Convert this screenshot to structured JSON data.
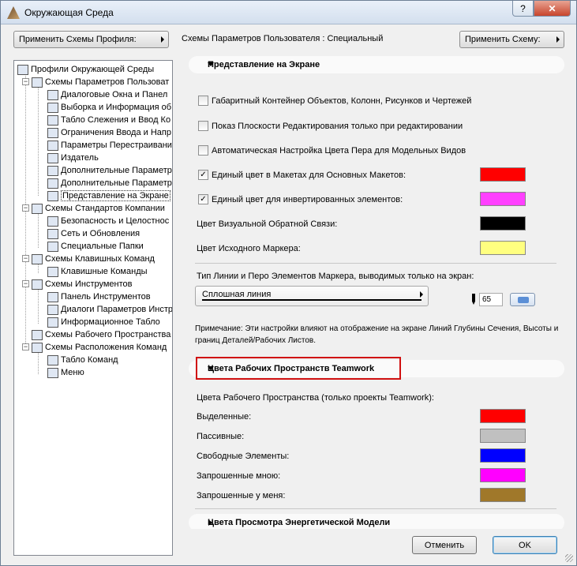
{
  "window": {
    "title": "Окружающая Среда",
    "help_label": "?",
    "close_label": "✕"
  },
  "toolbar": {
    "apply_profile_scheme": "Применить Схемы Профиля:",
    "scheme_label": "Схемы Параметров Пользователя : Специальный",
    "apply_scheme": "Применить Схему:"
  },
  "tree": {
    "items": [
      {
        "label": "Профили Окружающей Среды",
        "icon": "profiles-icon"
      },
      {
        "label": "Схемы Параметров Пользоват",
        "icon": "user-prefs-icon"
      },
      {
        "label": "Диалоговые Окна и Панел",
        "icon": "dialogs-icon"
      },
      {
        "label": "Выборка и Информация об",
        "icon": "selection-icon"
      },
      {
        "label": "Табло Слежения и Ввод Ко",
        "icon": "tracker-icon"
      },
      {
        "label": "Ограничения Ввода и Напр",
        "icon": "constraints-icon"
      },
      {
        "label": "Параметры Перестраивани",
        "icon": "rebuild-icon"
      },
      {
        "label": "Издатель",
        "icon": "publisher-icon"
      },
      {
        "label": "Дополнительные Параметр",
        "icon": "more-options-icon"
      },
      {
        "label": "Дополнительные Параметр",
        "icon": "more-options-2-icon"
      },
      {
        "label": "Представление на Экране",
        "icon": "on-screen-view-icon"
      },
      {
        "label": "Схемы Стандартов Компании",
        "icon": "company-standards-icon"
      },
      {
        "label": "Безопасность и Целостнос",
        "icon": "security-icon"
      },
      {
        "label": "Сеть и Обновления",
        "icon": "network-icon"
      },
      {
        "label": "Специальные Папки",
        "icon": "folders-icon"
      },
      {
        "label": "Схемы Клавишных Команд",
        "icon": "shortcut-schemes-icon"
      },
      {
        "label": "Клавишные Команды",
        "icon": "keyboard-icon"
      },
      {
        "label": "Схемы Инструментов",
        "icon": "tool-schemes-icon"
      },
      {
        "label": "Панель Инструментов",
        "icon": "toolbar-icon"
      },
      {
        "label": "Диалоги Параметров Инстр",
        "icon": "tool-settings-icon"
      },
      {
        "label": "Информационное Табло",
        "icon": "info-box-icon"
      },
      {
        "label": "Схемы Рабочего Пространства",
        "icon": "workspace-icon"
      },
      {
        "label": "Схемы Расположения Команд",
        "icon": "command-layout-icon"
      },
      {
        "label": "Табло Команд",
        "icon": "command-table-icon"
      },
      {
        "label": "Меню",
        "icon": "menu-icon"
      }
    ]
  },
  "screen_view": {
    "title": "Представление на Экране",
    "options": [
      {
        "label": "Габаритный Контейнер Объектов, Колонн, Рисунков и Чертежей",
        "checked": false
      },
      {
        "label": "Показ Плоскости Редактирования только при редактировании",
        "checked": false
      },
      {
        "label": "Автоматическая Настройка Цвета Пера для Модельных Видов",
        "checked": false
      },
      {
        "label": "Единый цвет в Макетах для Основных Макетов:",
        "checked": true,
        "color": "#ff0000"
      },
      {
        "label": "Единый цвет для инвертированных элементов:",
        "checked": true,
        "color": "#ff40ff"
      }
    ],
    "check_mark": "✓",
    "feedback_color_label": "Цвет Визуальной Обратной Связи:",
    "feedback_color": "#000000",
    "source_marker_label": "Цвет Исходного Маркера:",
    "source_marker_color": "#ffff80",
    "line_type_label": "Тип Линии и Перо Элементов Маркера, выводимых только на экран:",
    "line_type_value": "Сплошная линия",
    "pen_number": "65",
    "note": "Примечание: Эти настройки влияют на отображение на экране Линий Глубины Сечения, Высоты и границ Деталей/Рабочих Листов."
  },
  "teamwork": {
    "title": "Цвета Рабочих Пространств Teamwork",
    "subtitle": "Цвета Рабочего Пространства (только проекты Teamwork):",
    "rows": [
      {
        "label": "Выделенные:",
        "color": "#ff0000"
      },
      {
        "label": "Пассивные:",
        "color": "#c0c0c0"
      },
      {
        "label": "Свободные Элементы:",
        "color": "#0000ff"
      },
      {
        "label": "Запрошенные мною:",
        "color": "#ff00ff"
      },
      {
        "label": "Запрошенные у меня:",
        "color": "#a0782a"
      }
    ]
  },
  "energy": {
    "title": "Цвета Просмотра Энергетической Модели"
  },
  "footer": {
    "cancel": "Отменить",
    "ok": "OK"
  }
}
